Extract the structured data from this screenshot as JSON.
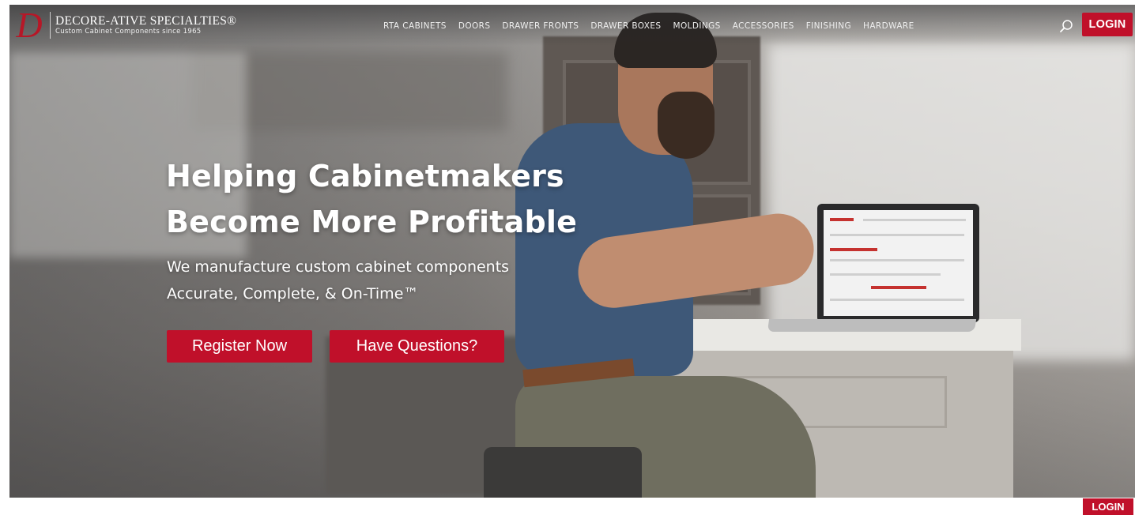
{
  "brand": {
    "monogram": "D",
    "name": "DECORE-ATIVE SPECIALTIES®",
    "tagline": "Custom Cabinet Components since 1965",
    "accent_color": "#c0102a"
  },
  "nav": {
    "items": [
      {
        "label": "RTA CABINETS"
      },
      {
        "label": "DOORS"
      },
      {
        "label": "DRAWER FRONTS"
      },
      {
        "label": "DRAWER BOXES"
      },
      {
        "label": "MOLDINGS"
      },
      {
        "label": "ACCESSORIES"
      },
      {
        "label": "FINISHING"
      },
      {
        "label": "HARDWARE"
      }
    ],
    "search_icon": "search-icon",
    "login_label": "LOGIN"
  },
  "hero": {
    "headline_line1": "Helping Cabinetmakers",
    "headline_line2": "Become More Profitable",
    "sub_line1": "We manufacture custom cabinet components",
    "sub_line2": "Accurate, Complete, & On-Time™",
    "register_label": "Register Now",
    "questions_label": "Have Questions?"
  },
  "footer_login_label": "LOGIN"
}
